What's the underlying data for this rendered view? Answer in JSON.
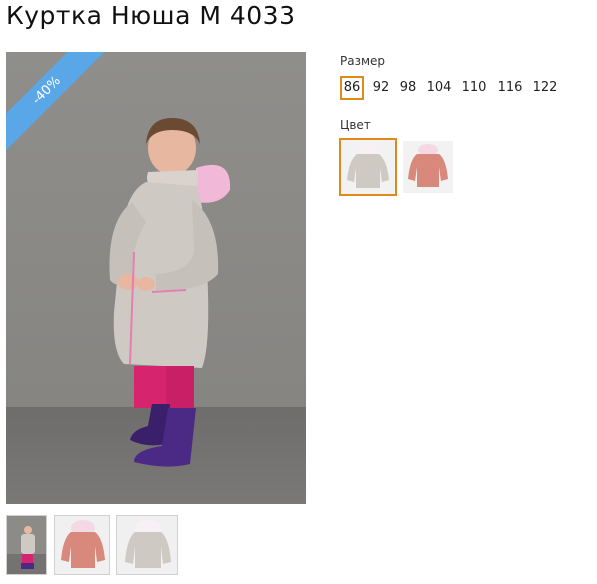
{
  "product": {
    "title": "Куртка Нюша М 4033"
  },
  "badge": {
    "discount": "-40%"
  },
  "size": {
    "label": "Размер",
    "options": [
      "86",
      "92",
      "98",
      "104",
      "110",
      "116",
      "122"
    ],
    "selected": "86"
  },
  "color": {
    "label": "Цвет",
    "options": [
      "grey",
      "coral"
    ],
    "selected": "grey"
  },
  "thumbnails": [
    "girl-photo",
    "coral-jacket",
    "grey-jacket"
  ],
  "colors": {
    "accent": "#e08a1d",
    "badge": "#5aa7e8",
    "jacket_grey": "#cfc9c4",
    "jacket_coral": "#d9887c",
    "fur": "#f2b8d8"
  }
}
